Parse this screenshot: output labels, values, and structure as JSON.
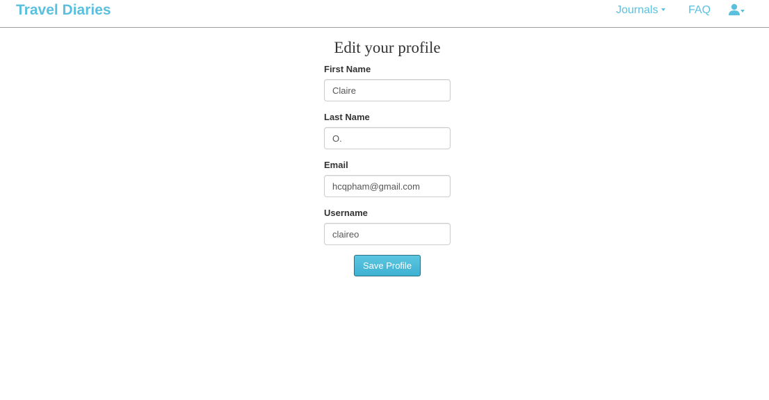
{
  "navbar": {
    "brand": "Travel Diaries",
    "journals_label": "Journals",
    "faq_label": "FAQ",
    "user_icon": "user-icon"
  },
  "page": {
    "title": "Edit your profile"
  },
  "form": {
    "first_name": {
      "label": "First Name",
      "value": "Claire"
    },
    "last_name": {
      "label": "Last Name",
      "value": "O."
    },
    "email": {
      "label": "Email",
      "value": "hcqpham@gmail.com"
    },
    "username": {
      "label": "Username",
      "value": "claireo"
    },
    "submit_label": "Save Profile"
  },
  "colors": {
    "accent": "#5bc0de",
    "button": "#46b8da",
    "text": "#333333"
  }
}
